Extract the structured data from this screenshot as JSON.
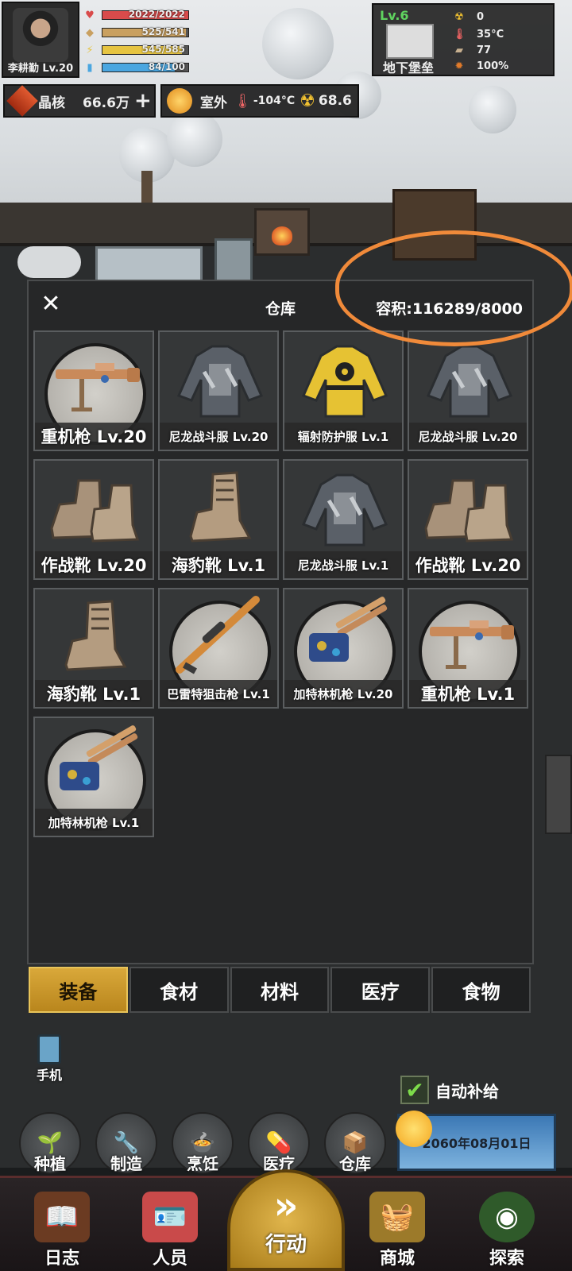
{
  "player": {
    "name_level": "李耕勤 Lv.20",
    "stats": [
      {
        "icon": "heart-icon",
        "value": "2022/2022",
        "fill": 1.0,
        "color": "#d94b4b"
      },
      {
        "icon": "food-icon",
        "value": "525/541",
        "fill": 0.97,
        "color": "#c9a060"
      },
      {
        "icon": "energy-icon",
        "value": "545/585",
        "fill": 0.93,
        "color": "#e6c441"
      },
      {
        "icon": "water-icon",
        "value": "84/100",
        "fill": 0.84,
        "color": "#4aa6e0"
      }
    ]
  },
  "base": {
    "level": "Lv.6",
    "name": "地下堡垒",
    "rows": [
      "0",
      "35°C",
      "77",
      "100%"
    ]
  },
  "resources": {
    "crystal_label": "晶核",
    "crystal_value": "66.6万",
    "plus": "+",
    "outdoor_label": "室外",
    "temperature": "-104°C",
    "radiation": "68.6"
  },
  "warehouse": {
    "title": "仓库",
    "capacity": "容积:116289/8000",
    "close": "✕",
    "items": [
      {
        "label": "重机枪 Lv.20",
        "icon": "machine-gun-icon",
        "round": true,
        "size": "lg"
      },
      {
        "label": "尼龙战斗服 Lv.20",
        "icon": "combat-suit-icon",
        "round": false,
        "size": "sm"
      },
      {
        "label": "辐射防护服 Lv.1",
        "icon": "radiation-suit-icon",
        "round": false,
        "size": "sm"
      },
      {
        "label": "尼龙战斗服 Lv.20",
        "icon": "combat-suit-icon",
        "round": false,
        "size": "sm"
      },
      {
        "label": "作战靴 Lv.20",
        "icon": "combat-boots-icon",
        "round": false,
        "size": "lg"
      },
      {
        "label": "海豹靴 Lv.1",
        "icon": "seal-boots-icon",
        "round": false,
        "size": "lg"
      },
      {
        "label": "尼龙战斗服 Lv.1",
        "icon": "combat-suit-icon",
        "round": false,
        "size": "sm"
      },
      {
        "label": "作战靴 Lv.20",
        "icon": "combat-boots-icon",
        "round": false,
        "size": "lg"
      },
      {
        "label": "海豹靴 Lv.1",
        "icon": "seal-boots-icon",
        "round": false,
        "size": "lg"
      },
      {
        "label": "巴雷特狙击枪 Lv.1",
        "icon": "sniper-rifle-icon",
        "round": true,
        "size": "sm"
      },
      {
        "label": "加特林机枪 Lv.20",
        "icon": "gatling-gun-icon",
        "round": true,
        "size": "sm"
      },
      {
        "label": "重机枪 Lv.1",
        "icon": "machine-gun-icon",
        "round": true,
        "size": "lg"
      },
      {
        "label": "加特林机枪 Lv.1",
        "icon": "gatling-gun-icon",
        "round": true,
        "size": "sm"
      }
    ]
  },
  "tabs": [
    {
      "label": "装备",
      "active": true
    },
    {
      "label": "食材",
      "active": false
    },
    {
      "label": "材料",
      "active": false
    },
    {
      "label": "医疗",
      "active": false
    },
    {
      "label": "食物",
      "active": false
    }
  ],
  "hud": {
    "phone": "手机",
    "auto_supply": "自动补给",
    "actions": [
      "种植",
      "制造",
      "烹饪",
      "医疗",
      "仓库"
    ],
    "date": "2060年08月01日"
  },
  "nav": {
    "log": "日志",
    "people": "人员",
    "action": "行动",
    "shop": "商城",
    "explore": "探索"
  },
  "colors": {
    "accent": "#d9a83a",
    "annotation": "#f08a3a"
  }
}
